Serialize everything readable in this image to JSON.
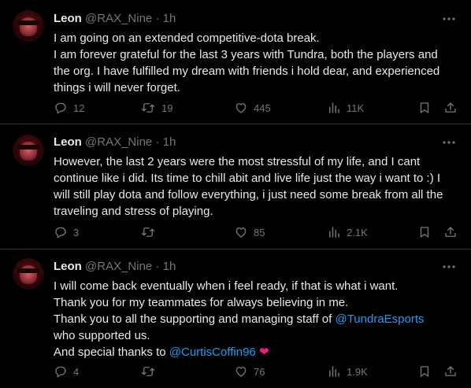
{
  "tweets": [
    {
      "name": "Leon",
      "handle": "@RAX_Nine",
      "sep": "·",
      "time": "1h",
      "lines": [
        "I am going on an extended competitive-dota break.",
        "I am forever grateful for the last 3 years with Tundra, both the players and",
        "the org. I have fulfilled my dream with friends i hold dear, and experienced",
        "things i will never forget."
      ],
      "replies": "12",
      "reposts": "19",
      "likes": "445",
      "views": "11K"
    },
    {
      "name": "Leon",
      "handle": "@RAX_Nine",
      "sep": "·",
      "time": "1h",
      "lines": [
        "However, the last 2 years were the most stressful of my life, and I cant",
        "continue like i did. Its time to chill abit and live life just the way i want to :) I",
        "will still play dota and follow everything, i just need some break from all the",
        "traveling and stress of playing."
      ],
      "replies": "3",
      "reposts": "",
      "likes": "85",
      "views": "2.1K"
    },
    {
      "name": "Leon",
      "handle": "@RAX_Nine",
      "sep": "·",
      "time": "1h",
      "lines": [
        "I will come back eventually when i feel ready, if that is what i want.",
        "Thank you for my teammates for always believing in me.",
        "Thank you to all the supporting and managing staff of ",
        "who supported us.",
        "And special thanks to "
      ],
      "mention_org": "@TundraEsports",
      "mention_user": "@CurtisCoffin96",
      "heart": "❤",
      "replies": "4",
      "reposts": "",
      "likes": "76",
      "views": "1.9K"
    }
  ],
  "icons": {
    "reply": "reply-icon",
    "repost": "repost-icon",
    "like": "like-icon",
    "views": "views-icon",
    "bookmark": "bookmark-icon",
    "share": "share-icon",
    "more": "more-icon"
  },
  "colors": {
    "background": "#000000",
    "text": "#e7e9ea",
    "muted": "#71767b",
    "link": "#1d9bf0",
    "heart": "#f91880",
    "divider": "#2f3336"
  }
}
